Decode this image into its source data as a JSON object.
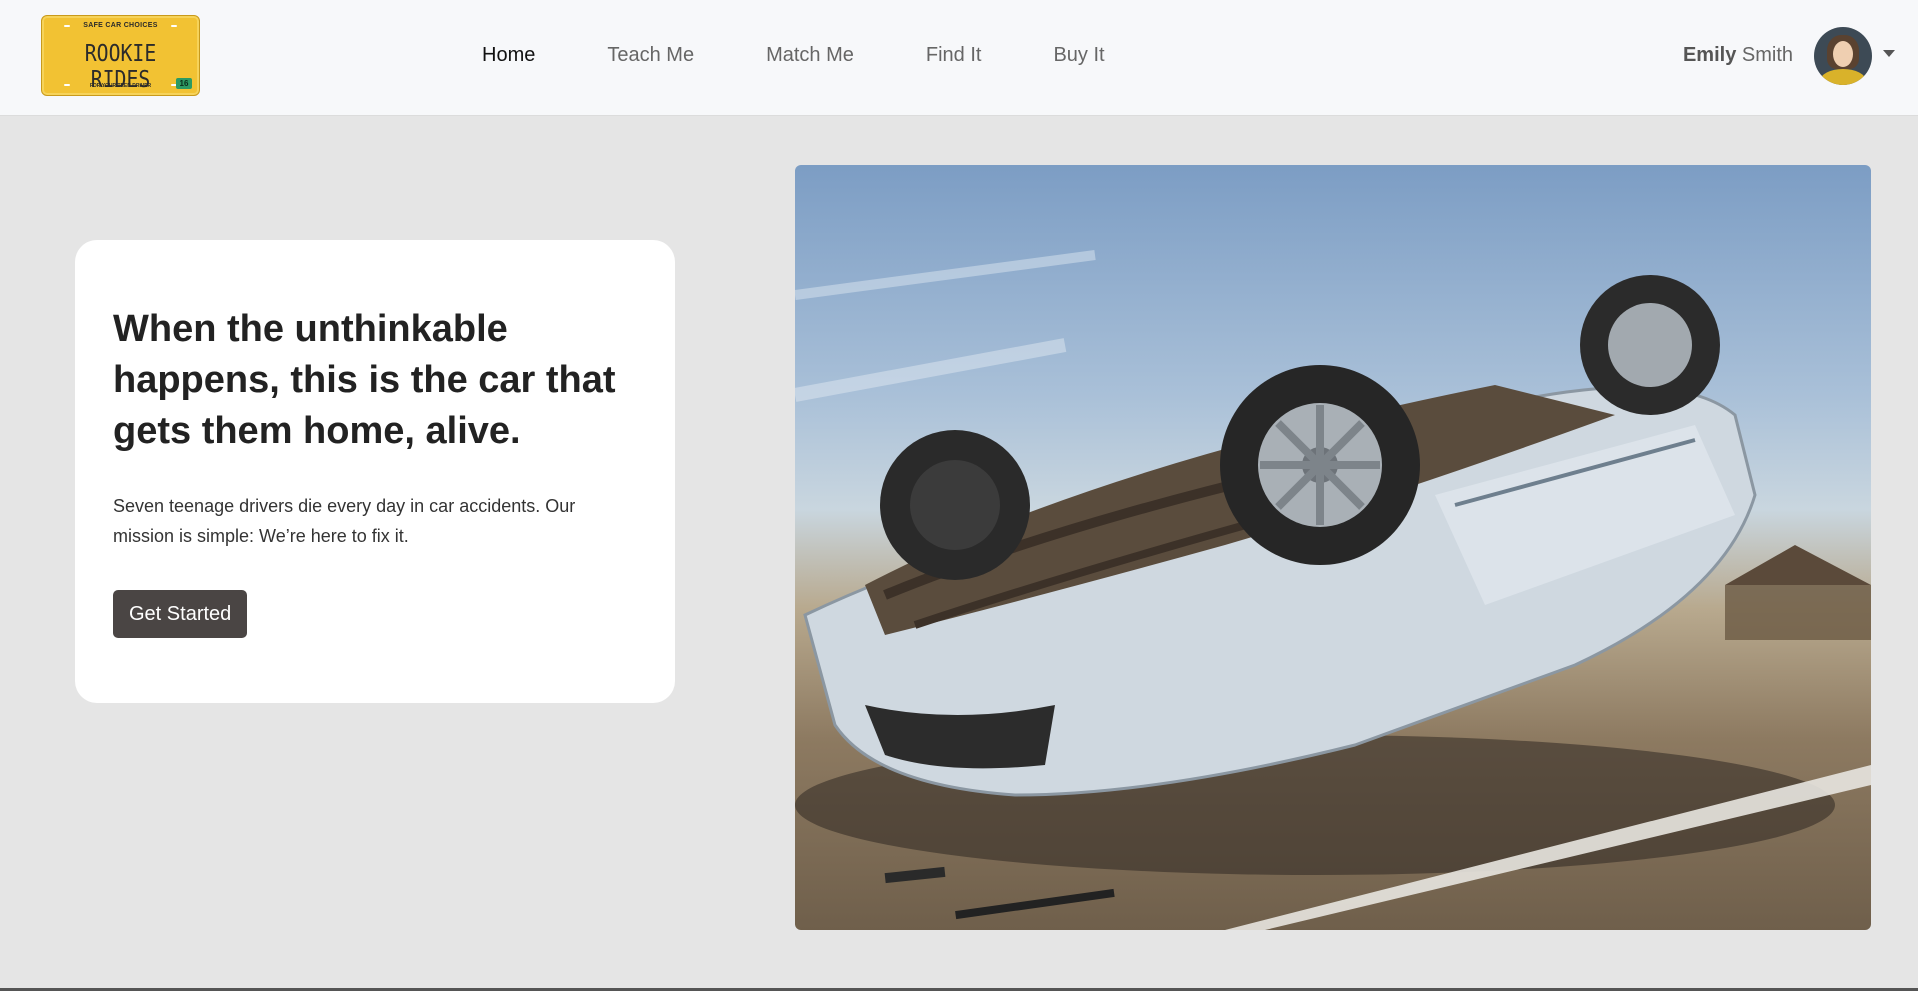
{
  "brand": {
    "top_text": "SAFE CAR CHOICES",
    "name": "ROOKIE RIDES",
    "bottom_text": "FOR YOUR TEEN DRIVER",
    "plate_number": "16",
    "color": "#f2c233"
  },
  "nav": {
    "items": [
      {
        "label": "Home",
        "active": true
      },
      {
        "label": "Teach Me",
        "active": false
      },
      {
        "label": "Match Me",
        "active": false
      },
      {
        "label": "Find It",
        "active": false
      },
      {
        "label": "Buy It",
        "active": false
      }
    ]
  },
  "user": {
    "first_name": "Emily",
    "last_name": "Smith",
    "avatar_icon": "user-avatar",
    "menu_icon": "caret-down-icon"
  },
  "hero": {
    "title": "When the unthinkable happens, this is the car that gets them home, alive.",
    "text": "Seven teenage drivers die every day in car accidents. Our mission is simple: We’re here to fix it.",
    "cta_label": "Get Started",
    "cta_color": "#4a4544",
    "image_description_icon": "overturned-car-photo"
  }
}
